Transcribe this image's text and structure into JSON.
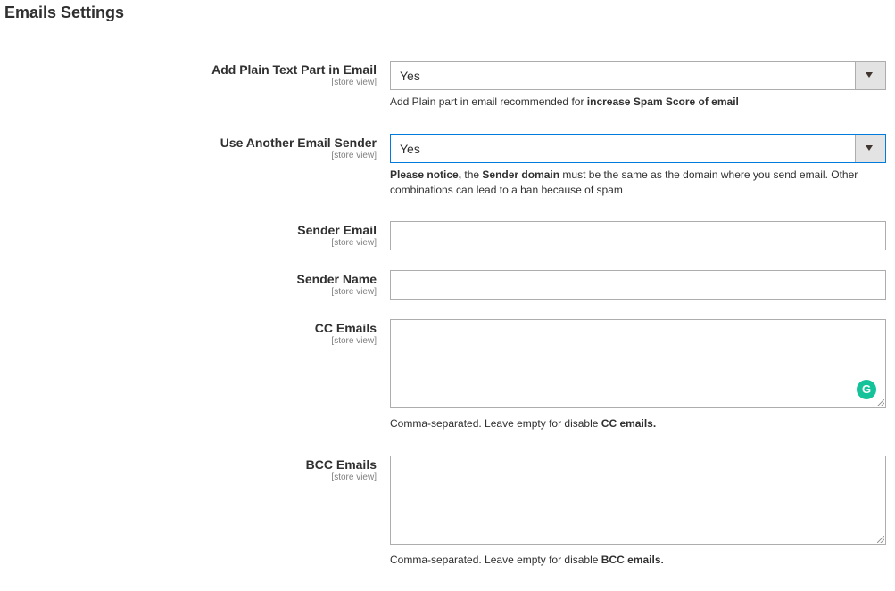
{
  "section": {
    "title": "Emails Settings"
  },
  "scope_label": "[store view]",
  "fields": {
    "plain_text": {
      "label": "Add Plain Text Part in Email",
      "value": "Yes",
      "note_prefix": "Add Plain part in email recommended for ",
      "note_bold": "increase Spam Score of email"
    },
    "another_sender": {
      "label": "Use Another Email Sender",
      "value": "Yes",
      "note_bold1": "Please notice,",
      "note_text1": " the ",
      "note_bold2": "Sender domain",
      "note_text2": " must be the same as the domain where you send email. Other combinations can lead to a ban because of spam"
    },
    "sender_email": {
      "label": "Sender Email",
      "value": ""
    },
    "sender_name": {
      "label": "Sender Name",
      "value": ""
    },
    "cc_emails": {
      "label": "CC Emails",
      "value": "",
      "note_prefix": "Comma-separated. Leave empty for disable ",
      "note_bold": "CC emails."
    },
    "bcc_emails": {
      "label": "BCC Emails",
      "value": "",
      "note_prefix": "Comma-separated. Leave empty for disable ",
      "note_bold": "BCC emails."
    }
  },
  "icons": {
    "grammarly": "grammarly-icon",
    "dropdown": "chevron-down-icon"
  },
  "colors": {
    "focus_border": "#007bdb",
    "grammarly": "#15c39a"
  }
}
